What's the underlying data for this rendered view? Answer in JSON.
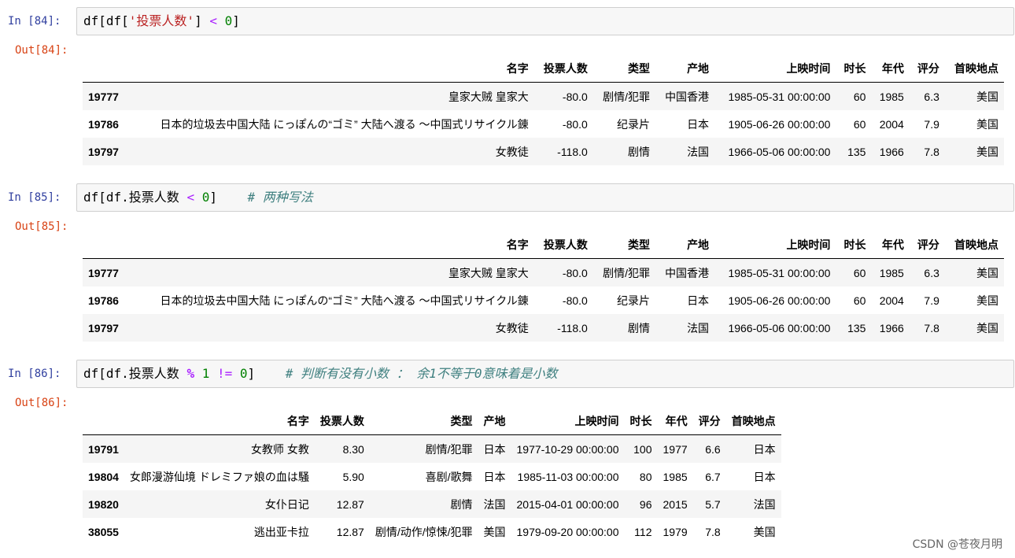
{
  "cells": [
    {
      "in_prompt": "In  [84]:",
      "out_prompt": "Out[84]:",
      "code": {
        "p1": "df[df[",
        "str": "'投票人数'",
        "p2": "] ",
        "op": "<",
        "p3": " ",
        "num": "0",
        "p4": "]"
      },
      "table": {
        "headers": [
          "",
          "名字",
          "投票人数",
          "类型",
          "产地",
          "上映时间",
          "时长",
          "年代",
          "评分",
          "首映地点"
        ],
        "rows": [
          [
            "19777",
            "皇家大贼 皇家大",
            "-80.0",
            "剧情/犯罪",
            "中国香港",
            "1985-05-31 00:00:00",
            "60",
            "1985",
            "6.3",
            "美国"
          ],
          [
            "19786",
            "日本的垃圾去中国大陆 にっぽんの“ゴミ” 大陆へ渡る ～中国式リサイクル錬",
            "-80.0",
            "纪录片",
            "日本",
            "1905-06-26 00:00:00",
            "60",
            "2004",
            "7.9",
            "美国"
          ],
          [
            "19797",
            "女教徒",
            "-118.0",
            "剧情",
            "法国",
            "1966-05-06 00:00:00",
            "135",
            "1966",
            "7.8",
            "美国"
          ]
        ]
      }
    },
    {
      "in_prompt": "In  [85]:",
      "out_prompt": "Out[85]:",
      "code": {
        "p1": "df[df.投票人数 ",
        "op": "<",
        "p2": " ",
        "num": "0",
        "p3": "]",
        "p4": "    ",
        "comment": "# 两种写法"
      },
      "table": {
        "headers": [
          "",
          "名字",
          "投票人数",
          "类型",
          "产地",
          "上映时间",
          "时长",
          "年代",
          "评分",
          "首映地点"
        ],
        "rows": [
          [
            "19777",
            "皇家大贼 皇家大",
            "-80.0",
            "剧情/犯罪",
            "中国香港",
            "1985-05-31 00:00:00",
            "60",
            "1985",
            "6.3",
            "美国"
          ],
          [
            "19786",
            "日本的垃圾去中国大陆 にっぽんの“ゴミ” 大陆へ渡る ～中国式リサイクル錬",
            "-80.0",
            "纪录片",
            "日本",
            "1905-06-26 00:00:00",
            "60",
            "2004",
            "7.9",
            "美国"
          ],
          [
            "19797",
            "女教徒",
            "-118.0",
            "剧情",
            "法国",
            "1966-05-06 00:00:00",
            "135",
            "1966",
            "7.8",
            "美国"
          ]
        ]
      }
    },
    {
      "in_prompt": "In  [86]:",
      "out_prompt": "Out[86]:",
      "code": {
        "p1": "df[df.投票人数 ",
        "op1": "%",
        "p2": " ",
        "num1": "1",
        "p3": " ",
        "op2": "!=",
        "p4": " ",
        "num2": "0",
        "p5": "]",
        "p6": "    ",
        "comment": "# 判断有没有小数 ： 余1不等于0意味着是小数"
      },
      "table": {
        "headers": [
          "",
          "名字",
          "投票人数",
          "类型",
          "产地",
          "上映时间",
          "时长",
          "年代",
          "评分",
          "首映地点"
        ],
        "rows": [
          [
            "19791",
            "女教师 女教",
            "8.30",
            "剧情/犯罪",
            "日本",
            "1977-10-29 00:00:00",
            "100",
            "1977",
            "6.6",
            "日本"
          ],
          [
            "19804",
            "女郎漫游仙境 ドレミファ娘の血は騒",
            "5.90",
            "喜剧/歌舞",
            "日本",
            "1985-11-03 00:00:00",
            "80",
            "1985",
            "6.7",
            "日本"
          ],
          [
            "19820",
            "女仆日记",
            "12.87",
            "剧情",
            "法国",
            "2015-04-01 00:00:00",
            "96",
            "2015",
            "5.7",
            "法国"
          ],
          [
            "38055",
            "逃出亚卡拉",
            "12.87",
            "剧情/动作/惊悚/犯罪",
            "美国",
            "1979-09-20 00:00:00",
            "112",
            "1979",
            "7.8",
            "美国"
          ]
        ]
      }
    }
  ],
  "watermark": "CSDN @苍夜月明"
}
